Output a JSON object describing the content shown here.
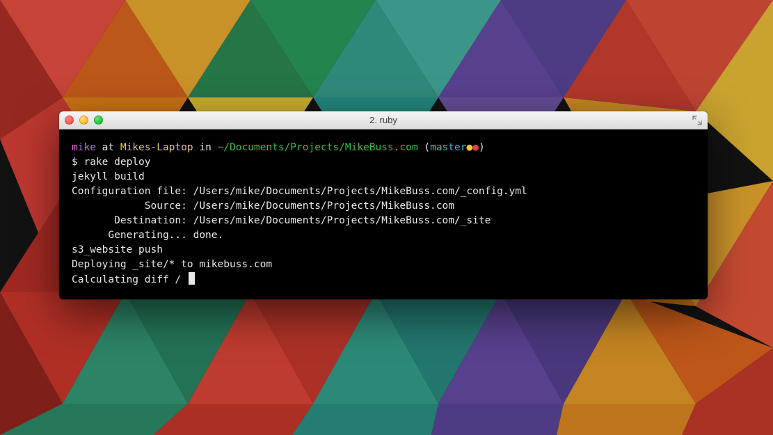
{
  "window": {
    "title": "2. ruby"
  },
  "prompt": {
    "user": "mike",
    "at": " at ",
    "host": "Mikes-Laptop",
    "in": " in ",
    "path": "~/Documents/Projects/MikeBuss.com",
    "open": " (",
    "branch": "master",
    "dot1": "●",
    "dot2": "●",
    "close": ")",
    "ps1": "$ ",
    "cmd": "rake deploy"
  },
  "lines": {
    "l1": "jekyll build",
    "l2": "Configuration file: /Users/mike/Documents/Projects/MikeBuss.com/_config.yml",
    "l3": "            Source: /Users/mike/Documents/Projects/MikeBuss.com",
    "l4": "       Destination: /Users/mike/Documents/Projects/MikeBuss.com/_site",
    "l5": "      Generating... done.",
    "l6": "s3_website push",
    "l7": "Deploying _site/* to mikebuss.com",
    "l8": "Calculating diff / "
  }
}
